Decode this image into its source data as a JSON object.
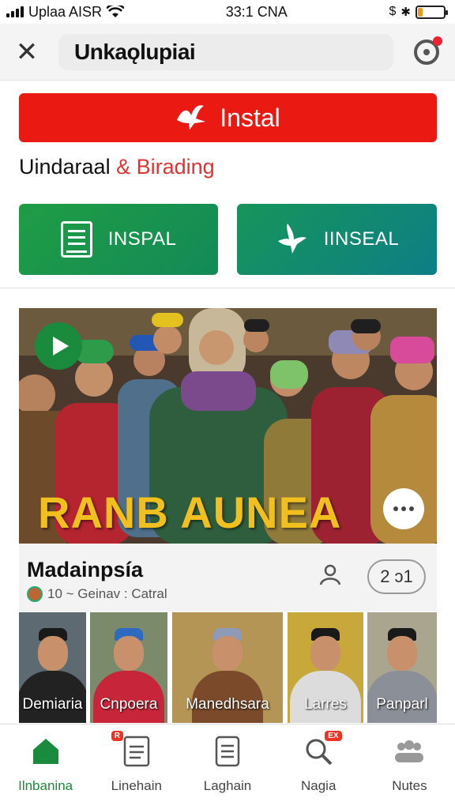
{
  "status_bar": {
    "carrier": "Uplaa AISR",
    "time": "33:1 CNA",
    "battery_level": 0.18
  },
  "header": {
    "brand": "Unkaǫlupiai",
    "has_notification": true
  },
  "install_banner": {
    "label": "Instal"
  },
  "headline": {
    "main": "Uindaraal",
    "accent": "& Birading"
  },
  "actions": [
    {
      "label": "INSPAL",
      "icon": "document-icon"
    },
    {
      "label": "IINSEAL",
      "icon": "bird-icon"
    }
  ],
  "video": {
    "title": "RANB AUNEA",
    "play_icon": "play-icon",
    "more_icon": "more-icon"
  },
  "channel": {
    "name": "Madainpsía",
    "meta": "10 ~ Geinav : Catral",
    "count": "2 ɔ1"
  },
  "thumbnails": [
    {
      "label": "Demiaria"
    },
    {
      "label": "Cnpoera"
    },
    {
      "label": "Manedhsara"
    },
    {
      "label": "Larres"
    },
    {
      "label": "Panparl"
    }
  ],
  "nav": [
    {
      "label": "Ilnbanina",
      "icon": "home-icon",
      "active": true
    },
    {
      "label": "Linehain",
      "icon": "document-icon",
      "badge": "R"
    },
    {
      "label": "Laghain",
      "icon": "list-icon"
    },
    {
      "label": "Nagia",
      "icon": "search-icon",
      "badge": "EX"
    },
    {
      "label": "Nutes",
      "icon": "people-icon"
    }
  ],
  "colors": {
    "accent_red": "#ea1a13",
    "accent_green": "#1a8a3c",
    "teal": "#0e7e86",
    "gold_text": "#f2c01e"
  }
}
